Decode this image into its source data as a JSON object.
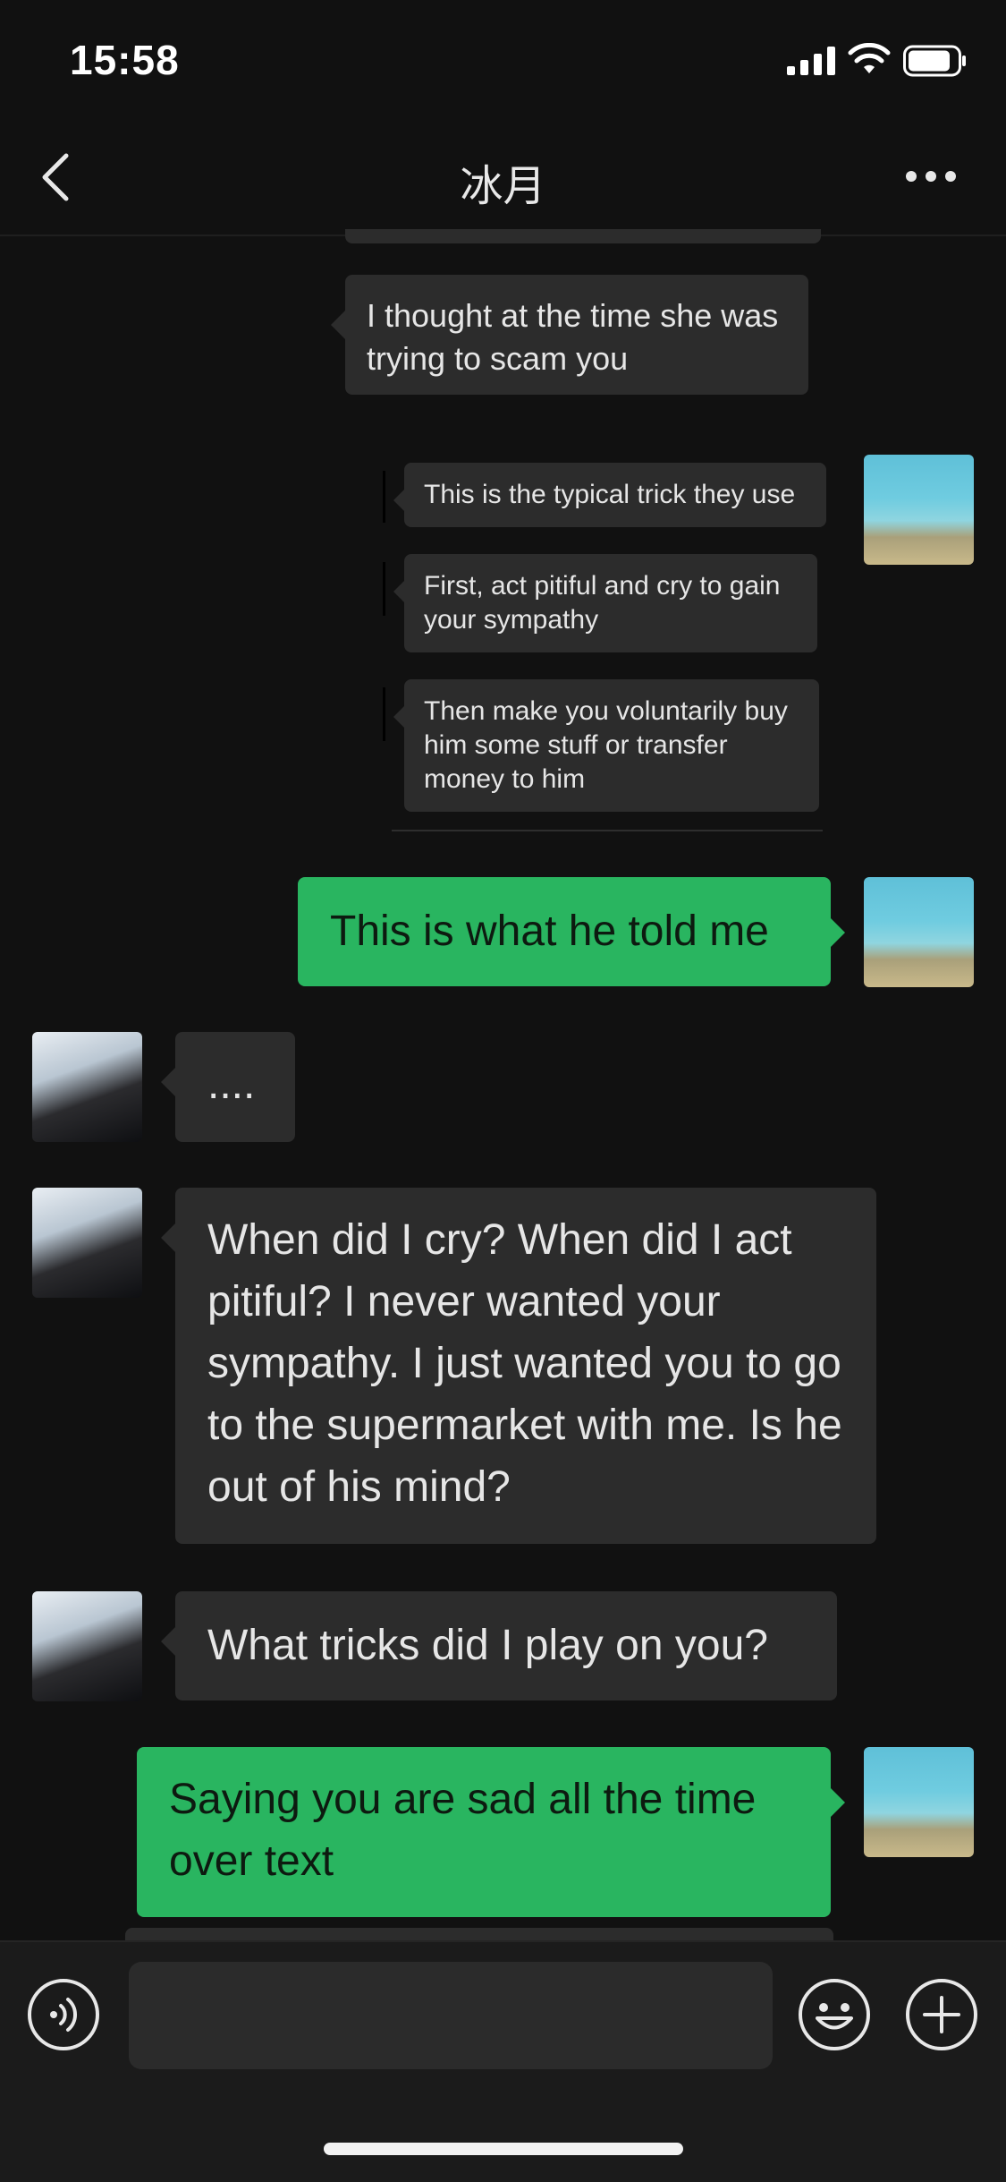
{
  "status": {
    "time": "15:58"
  },
  "nav": {
    "title": "冰月"
  },
  "messages": {
    "m1": "I thought at the time she was trying to scam you",
    "q1": "This is the typical trick they use",
    "q2": "First, act pitiful and cry to gain your sympathy",
    "q3": "Then make you voluntarily buy him some stuff or transfer money to him",
    "m2": "This is what he told me",
    "m3": "....",
    "m4": "When did I cry? When did I act pitiful? I never wanted your sympathy. I just wanted you to go to the supermarket with me. Is he out of his mind?",
    "m5": "What tricks did I play on you?",
    "m6": "Saying you are sad all the time over text"
  },
  "colors": {
    "green_bubble": "#29b560",
    "gray_bubble": "#2c2c2c",
    "background": "#111111"
  },
  "icons": [
    "back-icon",
    "more-icon",
    "voice-icon",
    "emoji-icon",
    "plus-icon"
  ]
}
